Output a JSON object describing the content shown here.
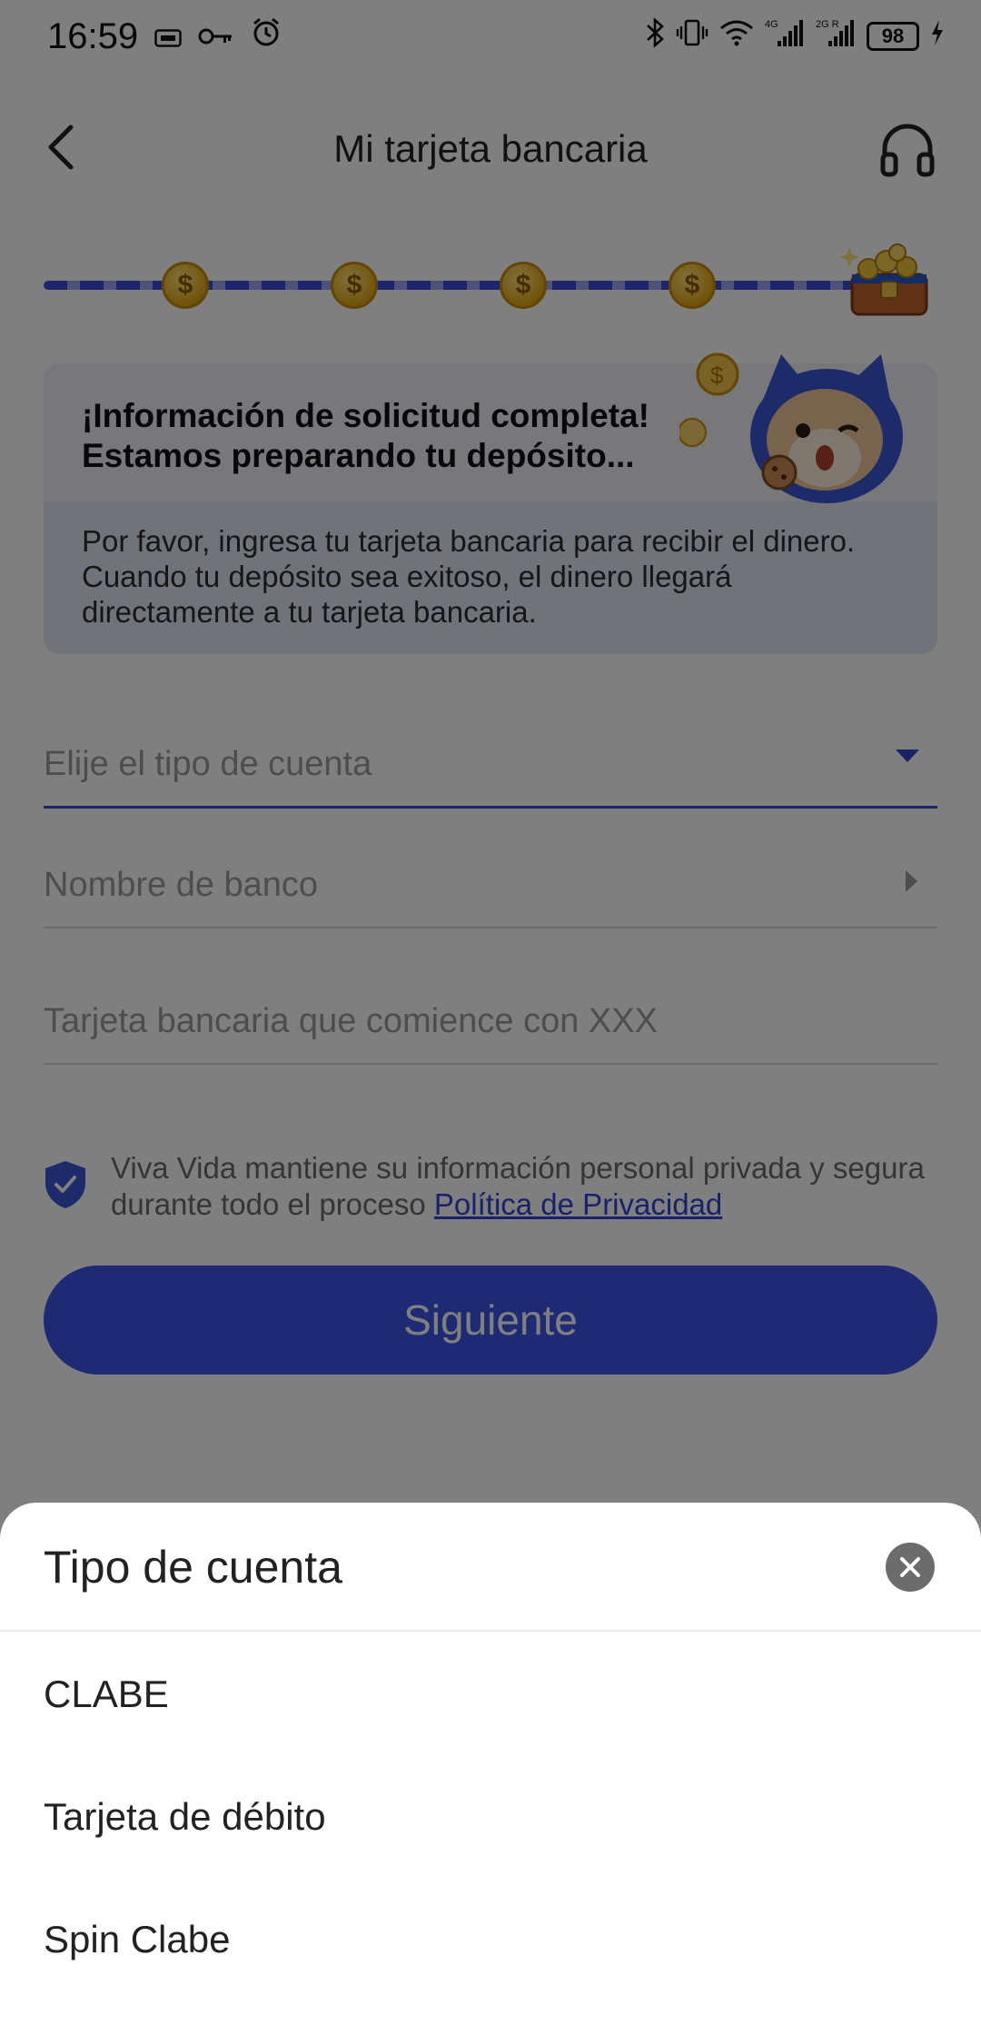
{
  "status_bar": {
    "time": "16:59",
    "battery": "98",
    "network_1": "4G",
    "network_2": "2G R"
  },
  "header": {
    "title": "Mi tarjeta bancaria",
    "back_icon": "chevron-left-icon",
    "support_icon": "headset-icon"
  },
  "progress": {
    "coin_symbol": "$",
    "steps_completed": 4,
    "total_steps": 5
  },
  "info_card": {
    "title_line1": "¡Información de solicitud completa!",
    "title_line2": "Estamos preparando tu depósito...",
    "body": "Por favor, ingresa tu tarjeta bancaria para recibir el dinero. Cuando tu depósito sea exitoso, el dinero llegará directamente a tu tarjeta bancaria."
  },
  "form": {
    "account_type_placeholder": "Elije el tipo de cuenta",
    "bank_name_placeholder": "Nombre de banco",
    "card_number_placeholder": "Tarjeta bancaria que comience con XXX"
  },
  "privacy": {
    "text": "Viva Vida mantiene su información personal privada y segura durante todo el proceso ",
    "link": "Política de Privacidad"
  },
  "next_button": {
    "label": "Siguiente"
  },
  "sheet": {
    "title": "Tipo de cuenta",
    "options": [
      {
        "label": "CLABE"
      },
      {
        "label": "Tarjeta de débito"
      },
      {
        "label": "Spin Clabe"
      }
    ]
  },
  "colors": {
    "primary": "#3e54e8",
    "accent_link": "#2f45d6",
    "overlay": "rgba(0,0,0,0.5)"
  }
}
